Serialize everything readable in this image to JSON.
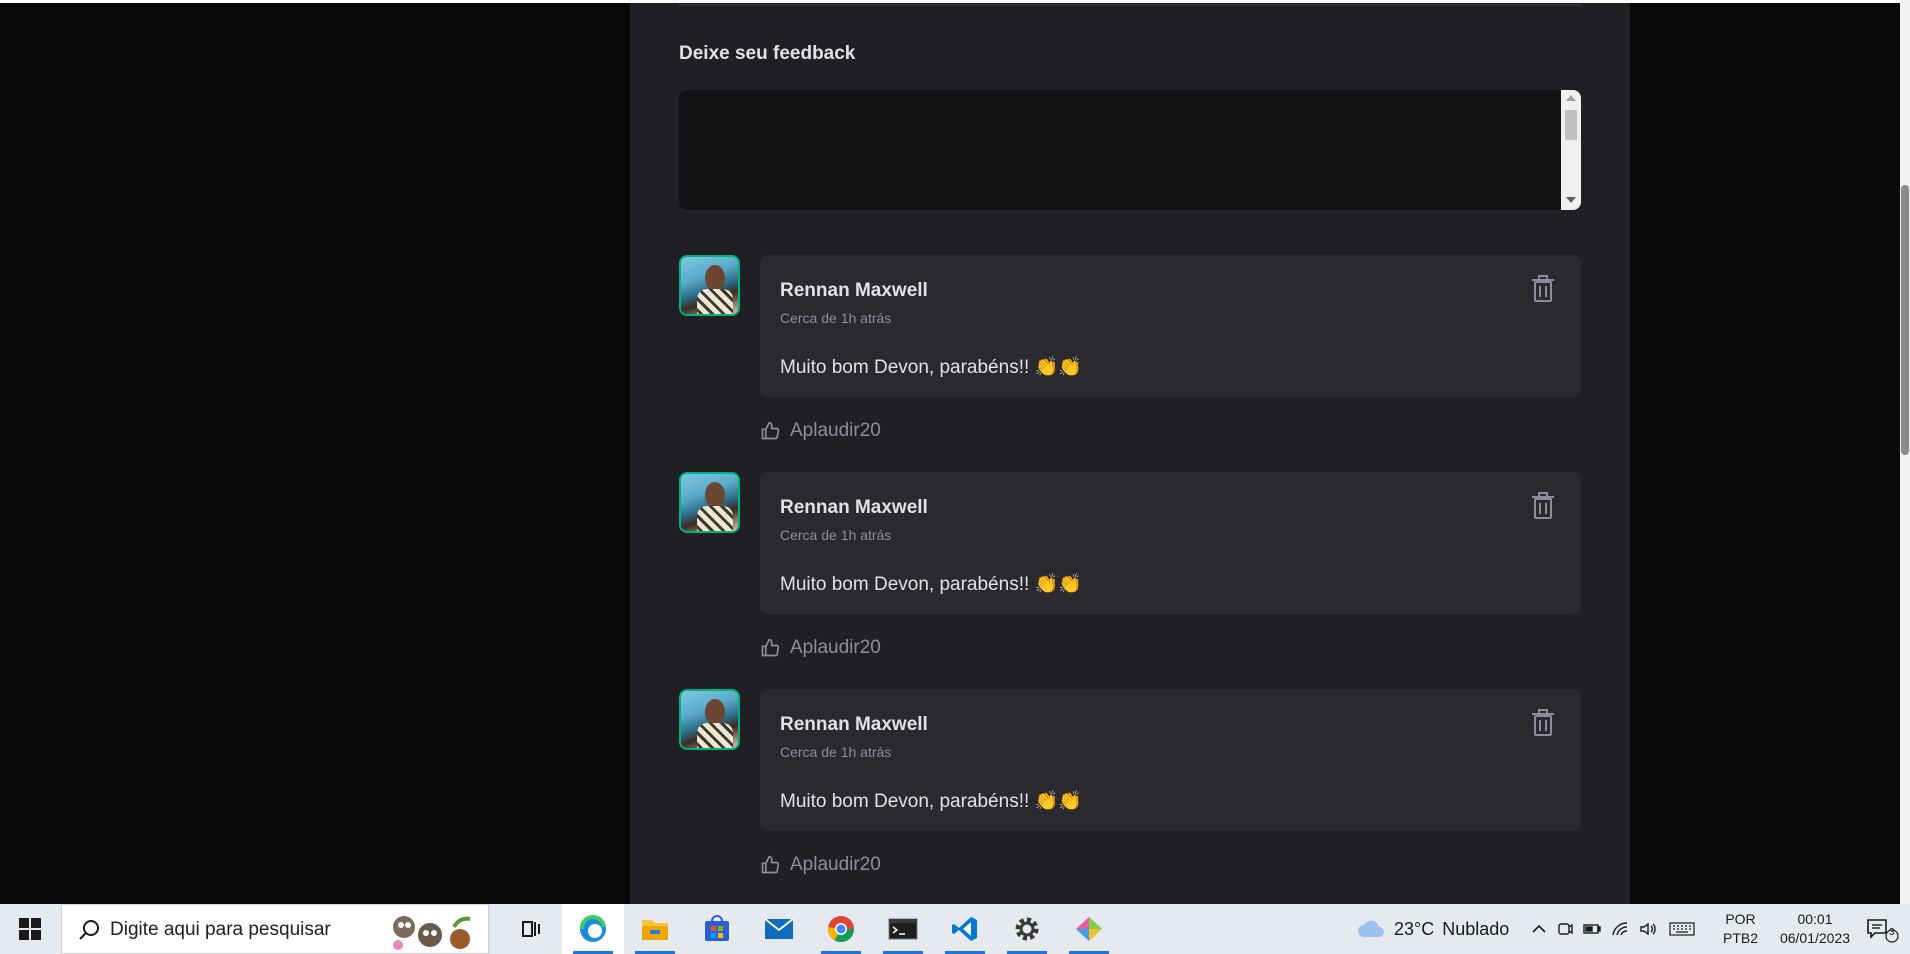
{
  "feedback": {
    "title": "Deixe seu feedback",
    "placeholder": ""
  },
  "comments": [
    {
      "author": "Rennan Maxwell",
      "time": "Cerca de 1h atrás",
      "content": "Muito bom Devon, parabéns!! 👏👏",
      "applaud_label": "Aplaudir",
      "applaud_count": "20"
    },
    {
      "author": "Rennan Maxwell",
      "time": "Cerca de 1h atrás",
      "content": "Muito bom Devon, parabéns!! 👏👏",
      "applaud_label": "Aplaudir",
      "applaud_count": "20"
    },
    {
      "author": "Rennan Maxwell",
      "time": "Cerca de 1h atrás",
      "content": "Muito bom Devon, parabéns!! 👏👏",
      "applaud_label": "Aplaudir",
      "applaud_count": "20"
    }
  ],
  "taskbar": {
    "search_placeholder": "Digite aqui para pesquisar",
    "apps": [
      "task-view",
      "edge",
      "file-explorer",
      "microsoft-store",
      "mail",
      "chrome",
      "terminal",
      "vscode",
      "settings",
      "git-client"
    ],
    "weather_temp": "23°C",
    "weather_desc": "Nublado",
    "lang_top": "POR",
    "lang_bottom": "PTB2",
    "time": "00:01",
    "date": "06/01/2023",
    "notification_count": "3"
  },
  "colors": {
    "page_bg": "#09090a",
    "card_bg": "#202024",
    "comment_bg": "#29292e",
    "accent": "#00b37e",
    "text": "#e1e1e6",
    "muted": "#8d8d99"
  }
}
